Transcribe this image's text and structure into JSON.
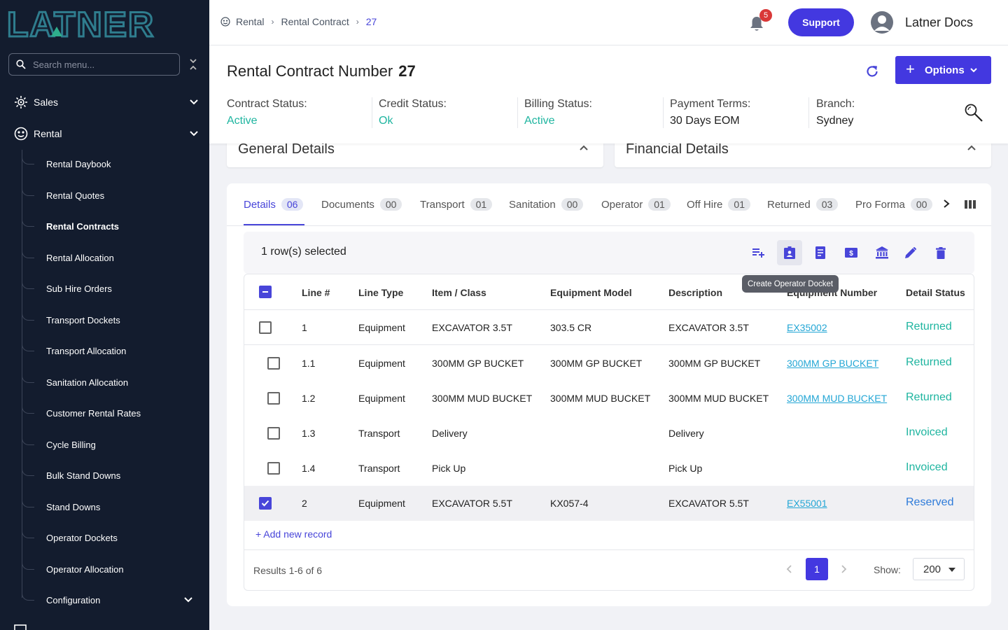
{
  "brand": {
    "logo_text": "LATNER",
    "accent": "#4338e0",
    "sidebar_bg": "#131c2e"
  },
  "sidebar": {
    "search_placeholder": "Search menu...",
    "sections": [
      {
        "label": "Sales",
        "icon": "sales-icon",
        "expanded": false
      },
      {
        "label": "Rental",
        "icon": "rental-icon",
        "expanded": true
      }
    ],
    "items": [
      {
        "label": "Rental Daybook"
      },
      {
        "label": "Rental Quotes"
      },
      {
        "label": "Rental Contracts",
        "active": true
      },
      {
        "label": "Rental Allocation"
      },
      {
        "label": "Sub Hire Orders"
      },
      {
        "label": "Transport Dockets"
      },
      {
        "label": "Transport Allocation"
      },
      {
        "label": "Sanitation Allocation"
      },
      {
        "label": "Customer Rental Rates"
      },
      {
        "label": "Cycle Billing"
      },
      {
        "label": "Bulk Stand Downs"
      },
      {
        "label": "Stand Downs"
      },
      {
        "label": "Operator Dockets"
      },
      {
        "label": "Operator Allocation"
      },
      {
        "label": "Configuration"
      }
    ]
  },
  "header": {
    "breadcrumbs": [
      "Rental",
      "Rental Contract",
      "27"
    ],
    "notifications": "5",
    "support_label": "Support",
    "user_name": "Latner Docs"
  },
  "contract": {
    "title": "Rental Contract Number",
    "number": "27",
    "options_label": "Options",
    "statuses": [
      {
        "label": "Contract Status:",
        "value": "Active"
      },
      {
        "label": "Credit Status:",
        "value": "Ok"
      },
      {
        "label": "Billing Status:",
        "value": "Active"
      },
      {
        "label": "Payment Terms:",
        "value": "30 Days EOM"
      },
      {
        "label": "Branch:",
        "value": "Sydney"
      }
    ]
  },
  "panels": {
    "general": "General Details",
    "financial": "Financial Details"
  },
  "tabs": [
    {
      "label": "Details",
      "count": "06",
      "active": true
    },
    {
      "label": "Documents",
      "count": "00"
    },
    {
      "label": "Transport",
      "count": "01"
    },
    {
      "label": "Sanitation",
      "count": "00"
    },
    {
      "label": "Operator",
      "count": "01"
    },
    {
      "label": "Off Hire",
      "count": "01"
    },
    {
      "label": "Returned",
      "count": "03"
    },
    {
      "label": "Pro Forma",
      "count": "00"
    }
  ],
  "selection": {
    "text": "1 row(s) selected",
    "tooltip": "Create Operator Docket"
  },
  "table": {
    "columns": [
      "Line #",
      "Line Type",
      "Item / Class",
      "Equipment Model",
      "Description",
      "Equipment Number",
      "Detail Status"
    ],
    "rows": [
      {
        "line": "1",
        "type": "Equipment",
        "item": "EXCAVATOR 3.5T",
        "model": "303.5 CR",
        "desc": "EXCAVATOR 3.5T",
        "equip": "EX35002",
        "status": "Returned",
        "checked": false,
        "child": false
      },
      {
        "line": "1.1",
        "type": "Equipment",
        "item": "300MM GP BUCKET",
        "model": "300MM GP BUCKET",
        "desc": "300MM GP BUCKET",
        "equip": "300MM GP BUCKET",
        "status": "Returned",
        "checked": false,
        "child": true
      },
      {
        "line": "1.2",
        "type": "Equipment",
        "item": "300MM MUD BUCKET",
        "model": "300MM MUD BUCKET",
        "desc": "300MM MUD BUCKET",
        "equip": "300MM MUD BUCKET",
        "status": "Returned",
        "checked": false,
        "child": true
      },
      {
        "line": "1.3",
        "type": "Transport",
        "item": "Delivery",
        "model": "",
        "desc": "Delivery",
        "equip": "",
        "status": "Invoiced",
        "checked": false,
        "child": true
      },
      {
        "line": "1.4",
        "type": "Transport",
        "item": "Pick Up",
        "model": "",
        "desc": "Pick Up",
        "equip": "",
        "status": "Invoiced",
        "checked": false,
        "child": true
      },
      {
        "line": "2",
        "type": "Equipment",
        "item": "EXCAVATOR 5.5T",
        "model": "KX057-4",
        "desc": "EXCAVATOR 5.5T",
        "equip": "EX55001",
        "status": "Reserved",
        "checked": true,
        "child": false
      }
    ],
    "add_record": "+ Add new record",
    "results": "Results 1-6 of 6",
    "page": "1",
    "show_label": "Show:",
    "page_size": "200"
  }
}
